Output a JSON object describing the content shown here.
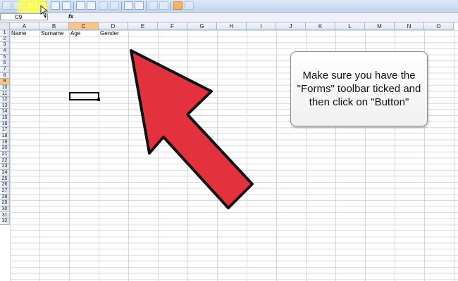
{
  "app": {
    "name_box": "C9",
    "formula_icon": "fx",
    "accent_color": "#e3323e",
    "highlight_color": "#ffff50"
  },
  "toolbar": {
    "buttons": [
      "label-icon",
      "button-icon",
      "checkbox-icon",
      "option-button-icon",
      "group-box-icon",
      "list-box-icon",
      "combo-box-icon",
      "scroll-bar-icon",
      "spinner-icon",
      "properties-icon",
      "edit-code-icon",
      "toggle-grid-icon",
      "run-dialog-icon"
    ]
  },
  "sheet": {
    "columns": [
      "A",
      "B",
      "C",
      "D",
      "E",
      "F",
      "G",
      "H",
      "I",
      "J",
      "K",
      "L",
      "M",
      "N",
      "O"
    ],
    "rows": [
      "1",
      "2",
      "3",
      "4",
      "5",
      "6",
      "7",
      "8",
      "9",
      "10",
      "11",
      "12",
      "13",
      "14",
      "15",
      "16",
      "17",
      "18",
      "19",
      "20",
      "21",
      "22",
      "23",
      "24",
      "25",
      "26",
      "27",
      "28",
      "29",
      "30",
      "31",
      "32"
    ],
    "active_column": "C",
    "active_row": "9",
    "cells": {
      "A1": "Name",
      "B1": "Surname",
      "C1": "Age",
      "D1": "Gender"
    }
  },
  "callout": {
    "text": "Make sure you have the \"Forms\" toolbar ticked and then click on \"Button\""
  }
}
